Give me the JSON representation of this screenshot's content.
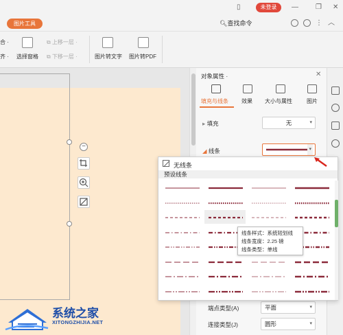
{
  "titlebar": {
    "login_label": "未登录"
  },
  "tabrow": {
    "active_tab": "图片工具",
    "search_command": "查找命令"
  },
  "ribbon": {
    "frag_top": "合 ·",
    "frag_bottom": "齐 ·",
    "selection_pane": "选择窗格",
    "move_up": "上移一层 ·",
    "move_down": "下移一层 ·",
    "img_to_text": "图片转文字",
    "img_to_pdf": "图片转PDF"
  },
  "panel": {
    "title": "对象属性 ·",
    "tabs": [
      {
        "label": "填充与线条",
        "icon": "fill-bucket-icon",
        "active": true
      },
      {
        "label": "效果",
        "icon": "effects-icon",
        "active": false
      },
      {
        "label": "大小与属性",
        "icon": "size-icon",
        "active": false
      },
      {
        "label": "图片",
        "icon": "picture-icon",
        "active": false
      }
    ],
    "fill_label": "填充",
    "fill_value": "无",
    "line_label": "线条",
    "join_type_label": "连接类型(J)",
    "join_type_value": "圆形",
    "cap_type_label": "端点类型(A)",
    "cap_type_value": "平面"
  },
  "dropdown": {
    "no_line": "无线条",
    "preset_header": "预设线条",
    "line_color": "#8b2a3a",
    "rows": [
      [
        "solid-thin",
        "solid-medium",
        "solid-thick-light",
        "solid-thick"
      ],
      [
        "dotted-thin",
        "dotted-medium",
        "dotted-light",
        "dotted-thick"
      ],
      [
        "dash-short-thin",
        "dash-short-medium",
        "dash-short-light",
        "dash-short-thick"
      ],
      [
        "dash-dot-thin",
        "dash-dot-medium",
        "dash-dot-light",
        "dash-dot-thick"
      ],
      [
        "dash-dot-dot-thin",
        "dash-dot-dot-medium",
        "dash-dot-dot-light",
        "dash-dot-dot-thick"
      ],
      [
        "long-dash-thin",
        "long-dash-medium",
        "long-dash-light",
        "long-dash-thick"
      ],
      [
        "long-dash-dot-thin",
        "long-dash-dot-medium",
        "long-dash-dot-light",
        "long-dash-dot-thick"
      ],
      [
        "long-dash-dot-dot-thin",
        "long-dash-dot-dot-medium",
        "long-dash-dot-dot-light",
        "long-dash-dot-dot-thick"
      ]
    ]
  },
  "tooltip": {
    "style": "线条样式：系统短划线",
    "width": "线条宽度：2.25 磅",
    "type": "线条类型：单线"
  },
  "watermark": {
    "title": "系统之家",
    "url": "XITONGZHIJIA.NET"
  }
}
